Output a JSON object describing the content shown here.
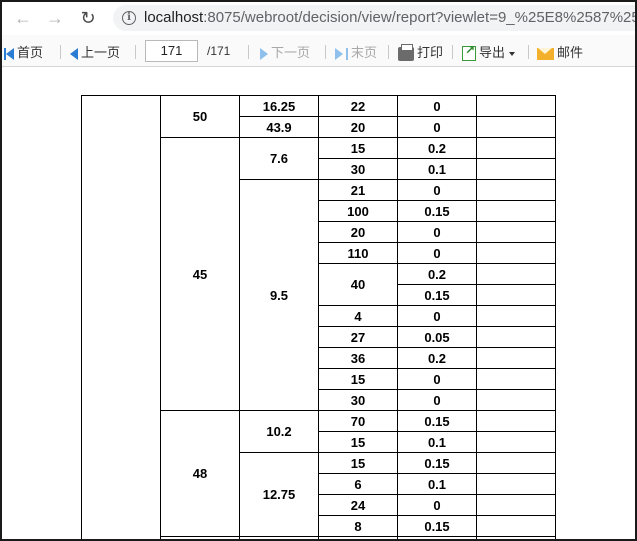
{
  "browser": {
    "url_host": "localhost",
    "url_rest": ":8075/webroot/decision/view/report?viewlet=9_%25E8%2587%25"
  },
  "toolbar": {
    "first": "首页",
    "prev": "上一页",
    "page_current": "171",
    "page_total": "/171",
    "next": "下一页",
    "last": "末页",
    "print": "打印",
    "export": "导出",
    "mail": "邮件"
  },
  "report": {
    "rows": [
      {
        "c1": "50",
        "c1_span": 2,
        "c2": "16.25",
        "c2_span": 1,
        "c3": "22",
        "c3_span": 1,
        "c4": "0"
      },
      {
        "c2": "43.9",
        "c2_span": 1,
        "c3": "20",
        "c3_span": 1,
        "c4": "0"
      },
      {
        "c1": "45",
        "c1_span": 13,
        "c2": "7.6",
        "c2_span": 2,
        "c3": "15",
        "c3_span": 1,
        "c4": "0.2"
      },
      {
        "c3": "30",
        "c3_span": 1,
        "c4": "0.1"
      },
      {
        "c2": "9.5",
        "c2_span": 11,
        "c3": "21",
        "c3_span": 1,
        "c4": "0"
      },
      {
        "c3": "100",
        "c3_span": 1,
        "c4": "0.15"
      },
      {
        "c3": "20",
        "c3_span": 1,
        "c4": "0"
      },
      {
        "c3": "110",
        "c3_span": 1,
        "c4": "0"
      },
      {
        "c3": "40",
        "c3_span": 2,
        "c4": "0.2"
      },
      {
        "c4": "0.15"
      },
      {
        "c3": "4",
        "c3_span": 1,
        "c4": "0"
      },
      {
        "c3": "27",
        "c3_span": 1,
        "c4": "0.05"
      },
      {
        "c3": "36",
        "c3_span": 1,
        "c4": "0.2"
      },
      {
        "c3": "15",
        "c3_span": 1,
        "c4": "0"
      },
      {
        "c3": "30",
        "c3_span": 1,
        "c4": "0"
      },
      {
        "c1": "48",
        "c1_span": 6,
        "c2": "10.2",
        "c2_span": 2,
        "c3": "70",
        "c3_span": 1,
        "c4": "0.15"
      },
      {
        "c3": "15",
        "c3_span": 1,
        "c4": "0.1"
      },
      {
        "c2": "12.75",
        "c2_span": 4,
        "c3": "15",
        "c3_span": 1,
        "c4": "0.15"
      },
      {
        "c3": "6",
        "c3_span": 1,
        "c4": "0.1"
      },
      {
        "c3": "24",
        "c3_span": 1,
        "c4": "0"
      },
      {
        "c3": "8",
        "c3_span": 1,
        "c4": "0.15"
      }
    ]
  }
}
